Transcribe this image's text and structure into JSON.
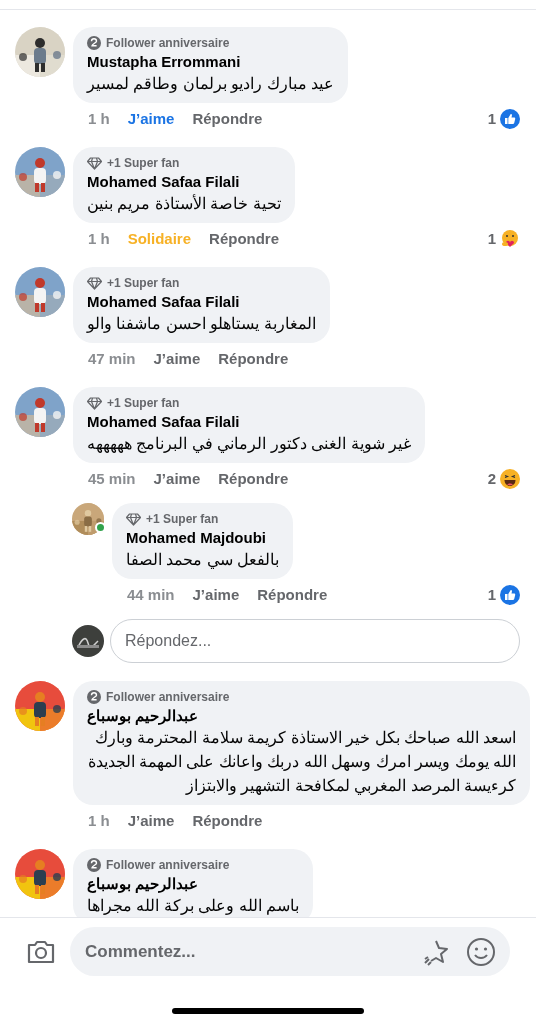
{
  "comments": [
    {
      "avatar": {
        "kind": "picture"
      },
      "badge": {
        "kind": "anniversary",
        "label": "Follower anniversaire"
      },
      "author": "Mustapha Errommani",
      "text": "عيد مبارك راديو برلمان وطاقم لمسير",
      "time": "1 h",
      "like": {
        "label": "J’aime",
        "reacted": true,
        "color": "#1b74e4"
      },
      "reply_label": "Répondre",
      "reactions": {
        "count": "1",
        "kind": "like"
      }
    },
    {
      "avatar": {
        "kind": "picture"
      },
      "badge": {
        "kind": "superfan",
        "label": "+1 Super fan"
      },
      "author": "Mohamed Safaa Filali",
      "text": "تحية خاصة الأستاذة مريم بنين",
      "time": "1 h",
      "like": {
        "label": "Solidaire",
        "reacted": true,
        "color": "#f7b125"
      },
      "reply_label": "Répondre",
      "reactions": {
        "count": "1",
        "kind": "care"
      }
    },
    {
      "avatar": {
        "kind": "picture"
      },
      "badge": {
        "kind": "superfan",
        "label": "+1 Super fan"
      },
      "author": "Mohamed Safaa Filali",
      "text": "المغاربة يستاهلو احسن ماشفنا والو",
      "time": "47 min",
      "like": {
        "label": "J’aime",
        "reacted": false
      },
      "reply_label": "Répondre"
    },
    {
      "avatar": {
        "kind": "picture"
      },
      "badge": {
        "kind": "superfan",
        "label": "+1 Super fan"
      },
      "author": "Mohamed Safaa Filali",
      "text": "غير شوية الغنى دكتور الرماني في البرنامج هههههه",
      "time": "45 min",
      "like": {
        "label": "J’aime",
        "reacted": false
      },
      "reply_label": "Répondre",
      "reactions": {
        "count": "2",
        "kind": "haha"
      },
      "replies": [
        {
          "avatar": {
            "kind": "picture",
            "online": true
          },
          "badge": {
            "kind": "superfan",
            "label": "+1 Super fan"
          },
          "author": "Mohamed Majdoubi",
          "text": "بالفعل سي محمد الصفا",
          "time": "44 min",
          "like": {
            "label": "J’aime",
            "reacted": false
          },
          "reply_label": "Répondre",
          "reactions": {
            "count": "1",
            "kind": "like"
          }
        }
      ],
      "reply_field": {
        "placeholder": "Répondez..."
      }
    },
    {
      "avatar": {
        "kind": "picture"
      },
      "badge": {
        "kind": "anniversary",
        "label": "Follower anniversaire"
      },
      "author": "عبدالرحيم بوسباع",
      "text": "اسعد الله صباحك بكل خير الاستاذة كريمة سلامة المحترمة وبارك الله يومك ويسر امرك وسهل الله دربك واعانك على المهمة الجديدة كرءيسة المرصد المغربي لمكافحة التشهير والابتزاز",
      "time": "1 h",
      "like": {
        "label": "J’aime",
        "reacted": false
      },
      "reply_label": "Répondre"
    },
    {
      "avatar": {
        "kind": "picture"
      },
      "badge": {
        "kind": "anniversary",
        "label": "Follower anniversaire"
      },
      "author": "عبدالرحيم بوسباع",
      "text": "باسم الله وعلى بركة الله مجراها"
    }
  ],
  "composer": {
    "placeholder": "Commentez..."
  }
}
